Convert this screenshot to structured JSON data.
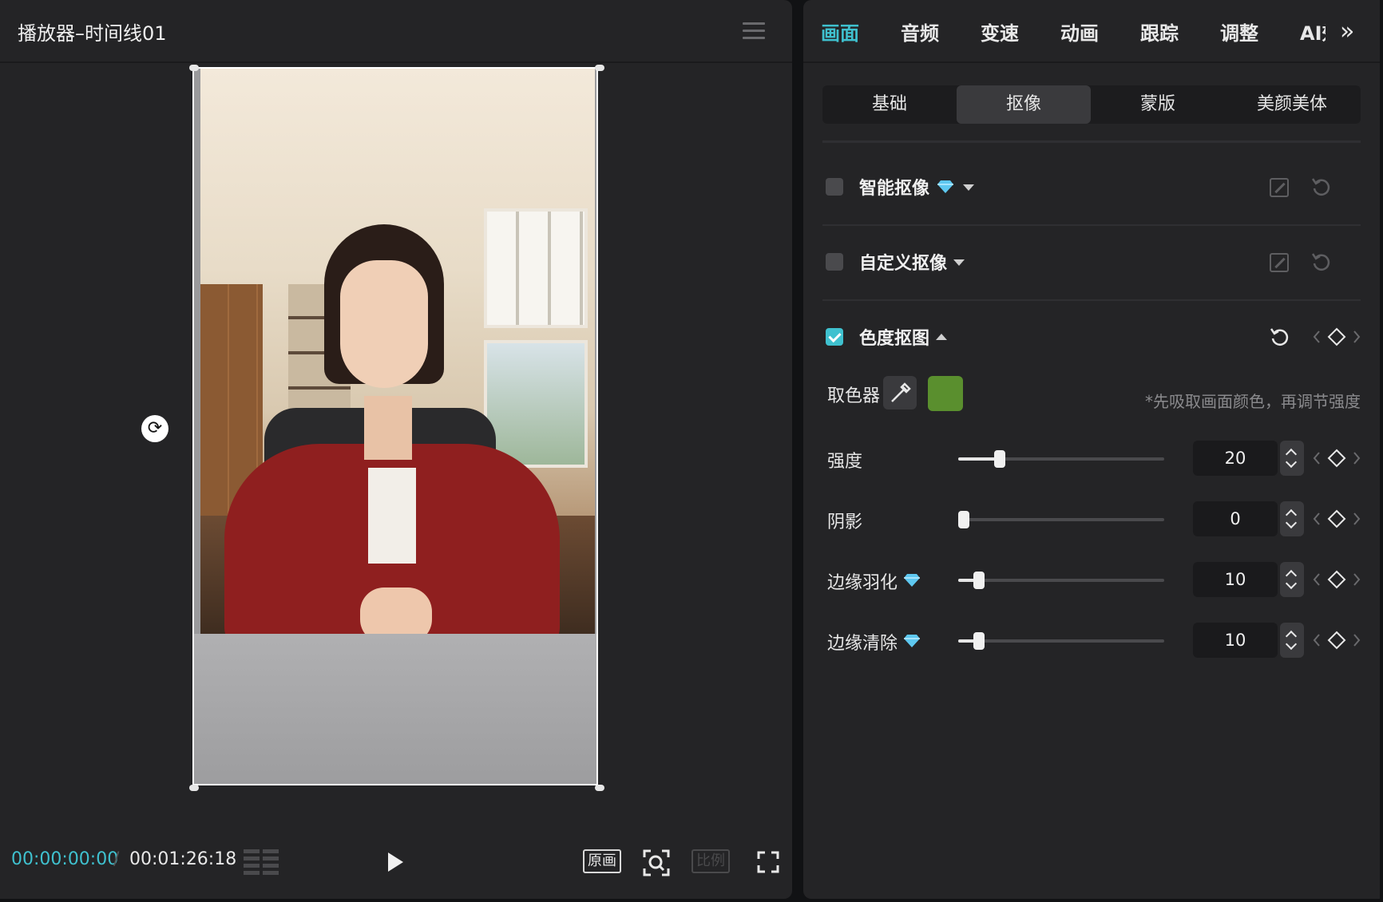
{
  "player": {
    "title": "播放器–时间线01",
    "timecode_current": "00:00:00:00",
    "timecode_separator": "/",
    "timecode_total": "00:01:26:18",
    "btn_original": "原画",
    "btn_ratio": "比例"
  },
  "inspector": {
    "tabs": [
      "画面",
      "音频",
      "变速",
      "动画",
      "跟踪",
      "调整",
      "AI效果"
    ],
    "active_tab": "画面",
    "subtabs": [
      "基础",
      "抠像",
      "蒙版",
      "美颜美体"
    ],
    "active_subtab": "抠像",
    "sections": {
      "smart": {
        "label": "智能抠像",
        "checked": false
      },
      "custom": {
        "label": "自定义抠像",
        "checked": false
      },
      "chroma": {
        "label": "色度抠图",
        "checked": true
      }
    },
    "color_picker": {
      "label": "取色器",
      "color": "#5a8f2e",
      "hint": "*先吸取画面颜色，再调节强度"
    },
    "params": [
      {
        "label": "强度",
        "value": "20",
        "fraction": 0.2,
        "premium": false
      },
      {
        "label": "阴影",
        "value": "0",
        "fraction": 0.0,
        "premium": false
      },
      {
        "label": "边缘羽化",
        "value": "10",
        "fraction": 0.1,
        "premium": true
      },
      {
        "label": "边缘清除",
        "value": "10",
        "fraction": 0.1,
        "premium": true
      }
    ]
  },
  "colors": {
    "accent": "#3fc1cf",
    "panel": "#242426",
    "premium_diamond": "#5ec8f0"
  }
}
